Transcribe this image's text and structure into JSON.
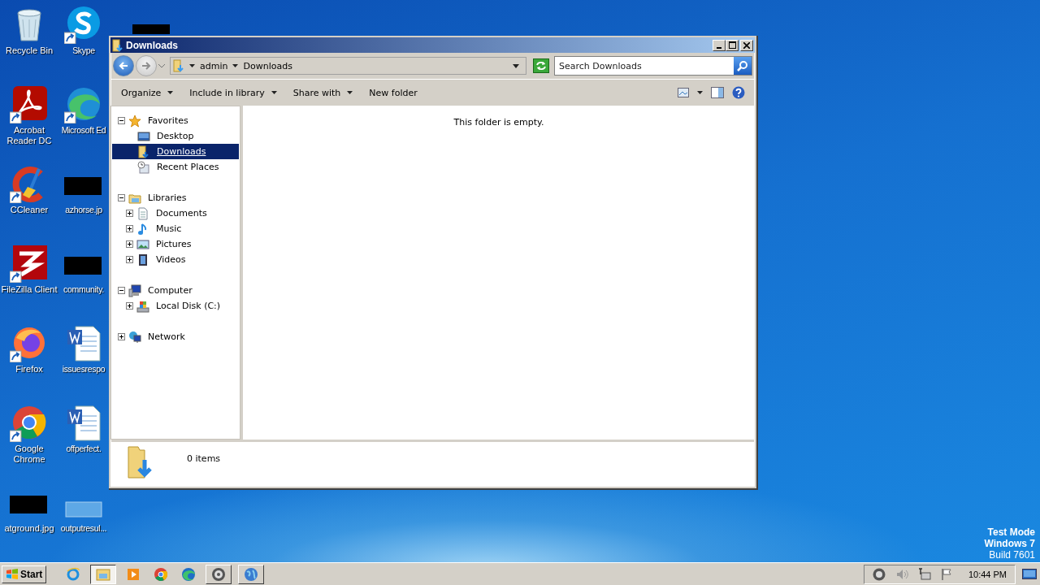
{
  "desktop": {
    "icons": [
      {
        "label": "Recycle Bin",
        "kind": "recycle",
        "shortcut": false
      },
      {
        "label": "Acrobat Reader DC",
        "kind": "acrobat",
        "shortcut": true
      },
      {
        "label": "CCleaner",
        "kind": "ccleaner",
        "shortcut": true
      },
      {
        "label": "FileZilla Client",
        "kind": "filezilla",
        "shortcut": true
      },
      {
        "label": "Firefox",
        "kind": "firefox",
        "shortcut": true
      },
      {
        "label": "Google Chrome",
        "kind": "chrome",
        "shortcut": true
      },
      {
        "label": "atground.jpg",
        "kind": "redacted",
        "shortcut": false
      },
      {
        "label": "Skype",
        "kind": "skype",
        "shortcut": true
      },
      {
        "label": "Microsoft Ed",
        "kind": "edge",
        "shortcut": true
      },
      {
        "label": "azhorse.jp",
        "kind": "redacted",
        "shortcut": false
      },
      {
        "label": "community.",
        "kind": "redacted",
        "shortcut": false
      },
      {
        "label": "issuesrespo",
        "kind": "word",
        "shortcut": false
      },
      {
        "label": "offperfect.",
        "kind": "word",
        "shortcut": false
      },
      {
        "label": "outputresul...",
        "kind": "blank",
        "shortcut": false
      }
    ],
    "os_notice": [
      "Test Mode",
      "Windows 7",
      "Build 7601"
    ]
  },
  "window": {
    "title": "Downloads",
    "address": {
      "crumbs": [
        "admin",
        "Downloads"
      ]
    },
    "search": {
      "placeholder": "Search Downloads"
    },
    "toolbar": [
      {
        "label": "Organize",
        "has_menu": true
      },
      {
        "label": "Include in library",
        "has_menu": true
      },
      {
        "label": "Share with",
        "has_menu": true
      },
      {
        "label": "New folder",
        "has_menu": false
      }
    ],
    "navigation": [
      {
        "label": "Favorites",
        "kind": "star",
        "expandable": true,
        "expanded": true,
        "selected": false,
        "children": [
          {
            "label": "Desktop",
            "kind": "desktop",
            "expandable": false,
            "selected": false
          },
          {
            "label": "Downloads",
            "kind": "downloads",
            "expandable": false,
            "selected": true
          },
          {
            "label": "Recent Places",
            "kind": "recent",
            "expandable": false,
            "selected": false
          }
        ]
      },
      {
        "label": "Libraries",
        "kind": "library",
        "expandable": true,
        "expanded": true,
        "selected": false,
        "children": [
          {
            "label": "Documents",
            "kind": "documents",
            "expandable": true,
            "expanded": false,
            "selected": false
          },
          {
            "label": "Music",
            "kind": "music",
            "expandable": true,
            "expanded": false,
            "selected": false
          },
          {
            "label": "Pictures",
            "kind": "pictures",
            "expandable": true,
            "expanded": false,
            "selected": false
          },
          {
            "label": "Videos",
            "kind": "videos",
            "expandable": true,
            "expanded": false,
            "selected": false
          }
        ]
      },
      {
        "label": "Computer",
        "kind": "computer",
        "expandable": true,
        "expanded": true,
        "selected": false,
        "children": [
          {
            "label": "Local Disk (C:)",
            "kind": "disk",
            "expandable": true,
            "expanded": false,
            "selected": false
          }
        ]
      },
      {
        "label": "Network",
        "kind": "network",
        "expandable": true,
        "expanded": false,
        "selected": false
      }
    ],
    "empty_message": "This folder is empty.",
    "details": {
      "count": "0 items"
    }
  },
  "taskbar": {
    "start": "Start",
    "items": [
      {
        "kind": "ie",
        "running": false,
        "active": false
      },
      {
        "kind": "explorer",
        "running": true,
        "active": true
      },
      {
        "kind": "media",
        "running": false,
        "active": false
      },
      {
        "kind": "chrome",
        "running": false,
        "active": false
      },
      {
        "kind": "edge",
        "running": false,
        "active": false
      },
      {
        "kind": "disc",
        "running": true,
        "active": false
      },
      {
        "kind": "globe",
        "running": true,
        "active": false
      }
    ],
    "tray": {
      "clock": "10:44 PM"
    }
  }
}
